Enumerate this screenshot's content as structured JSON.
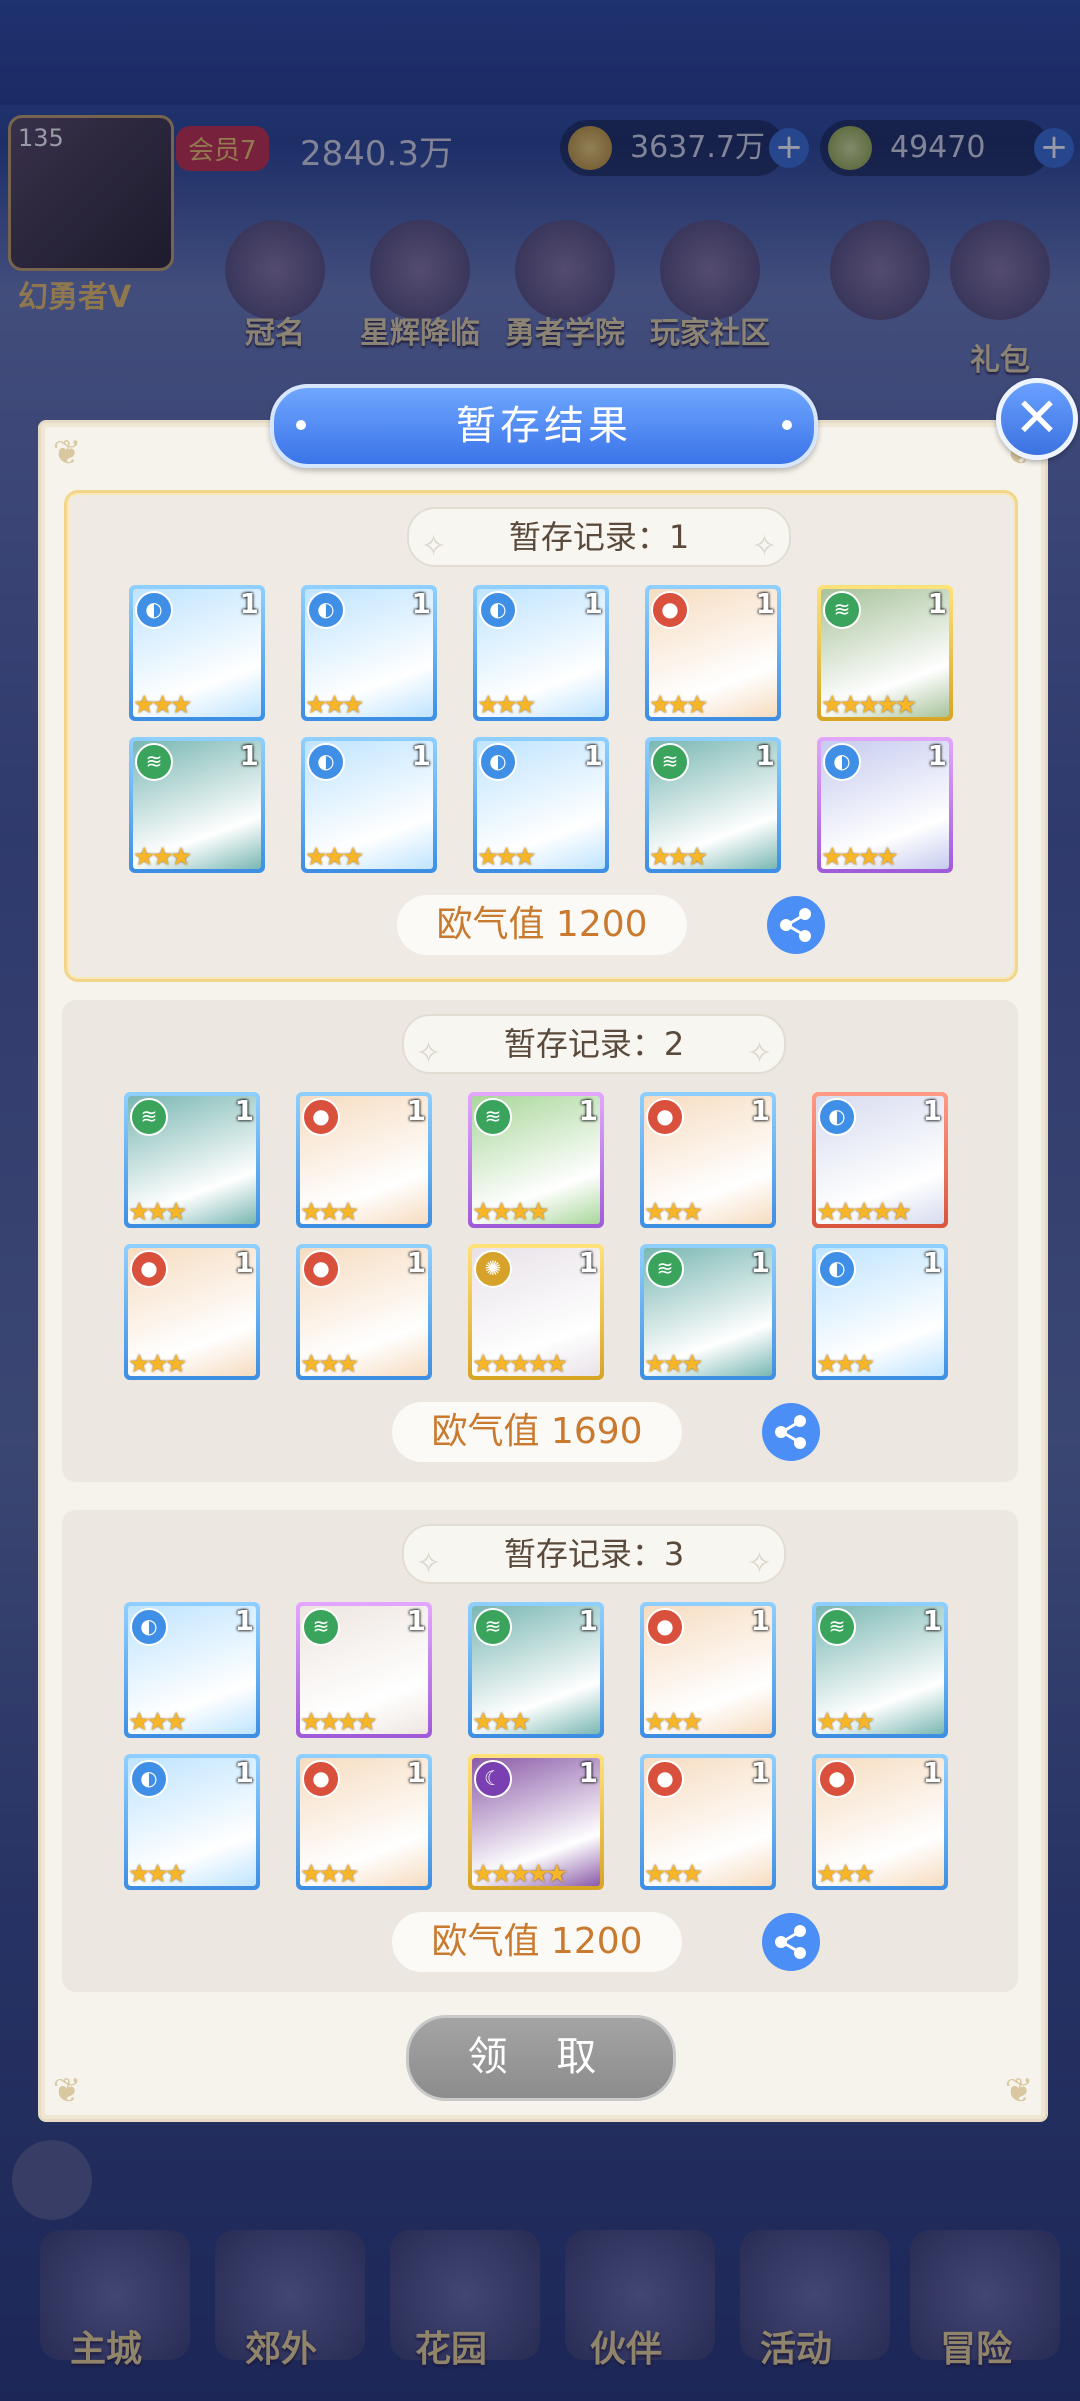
{
  "hud": {
    "level": "135",
    "username": "幻勇者V",
    "vip": "会员7",
    "power": "2840.3万",
    "gold": "3637.7万",
    "gems": "49470"
  },
  "menu": [
    "冠名",
    "星辉降临",
    "勇者学院",
    "玩家社区",
    "礼包"
  ],
  "nav": [
    "主城",
    "郊外",
    "花园",
    "伙伴",
    "活动",
    "冒险"
  ],
  "modal": {
    "title": "暂存结果",
    "claim_label": "领 取",
    "records": [
      {
        "label": "暂存记录：1",
        "score": "欧气值 1200",
        "cards": [
          {
            "rarity": "blue",
            "element": "water",
            "stars": "★★★",
            "count": "1",
            "art": "#bfe4ff"
          },
          {
            "rarity": "blue",
            "element": "water",
            "stars": "★★★",
            "count": "1",
            "art": "#bfe4ff"
          },
          {
            "rarity": "blue",
            "element": "water",
            "stars": "★★★",
            "count": "1",
            "art": "#bfe4ff"
          },
          {
            "rarity": "blue",
            "element": "fire",
            "stars": "★★★",
            "count": "1",
            "art": "#f6dcc0"
          },
          {
            "rarity": "gold",
            "element": "wind",
            "stars": "★★★★★",
            "count": "1",
            "art": "#a7c29a"
          },
          {
            "rarity": "blue",
            "element": "wind",
            "stars": "★★★",
            "count": "1",
            "art": "#79b7b2"
          },
          {
            "rarity": "blue",
            "element": "water",
            "stars": "★★★",
            "count": "1",
            "art": "#bfe4ff"
          },
          {
            "rarity": "blue",
            "element": "water",
            "stars": "★★★",
            "count": "1",
            "art": "#bfe4ff"
          },
          {
            "rarity": "blue",
            "element": "wind",
            "stars": "★★★",
            "count": "1",
            "art": "#79b7b2"
          },
          {
            "rarity": "purple",
            "element": "water",
            "stars": "★★★★",
            "count": "1",
            "art": "#c5cbef"
          }
        ]
      },
      {
        "label": "暂存记录：2",
        "score": "欧气值 1690",
        "cards": [
          {
            "rarity": "blue",
            "element": "wind",
            "stars": "★★★",
            "count": "1",
            "art": "#79b7b2"
          },
          {
            "rarity": "blue",
            "element": "fire",
            "stars": "★★★",
            "count": "1",
            "art": "#f6dcc0"
          },
          {
            "rarity": "purple",
            "element": "wind",
            "stars": "★★★★",
            "count": "1",
            "art": "#a9d79a"
          },
          {
            "rarity": "blue",
            "element": "fire",
            "stars": "★★★",
            "count": "1",
            "art": "#f6dcc0"
          },
          {
            "rarity": "red",
            "element": "water",
            "stars": "★★★★★",
            "count": "1",
            "art": "#d7dcef"
          },
          {
            "rarity": "blue",
            "element": "fire",
            "stars": "★★★",
            "count": "1",
            "art": "#f6dcc0"
          },
          {
            "rarity": "blue",
            "element": "fire",
            "stars": "★★★",
            "count": "1",
            "art": "#f6dcc0"
          },
          {
            "rarity": "gold",
            "element": "light",
            "stars": "★★★★★",
            "count": "1",
            "art": "#e8e2e8"
          },
          {
            "rarity": "blue",
            "element": "wind",
            "stars": "★★★",
            "count": "1",
            "art": "#79b7b2"
          },
          {
            "rarity": "blue",
            "element": "water",
            "stars": "★★★",
            "count": "1",
            "art": "#bfe4ff"
          }
        ]
      },
      {
        "label": "暂存记录：3",
        "score": "欧气值 1200",
        "cards": [
          {
            "rarity": "blue",
            "element": "water",
            "stars": "★★★",
            "count": "1",
            "art": "#bfe4ff"
          },
          {
            "rarity": "purple",
            "element": "wind",
            "stars": "★★★★",
            "count": "1",
            "art": "#eee6e0"
          },
          {
            "rarity": "blue",
            "element": "wind",
            "stars": "★★★",
            "count": "1",
            "art": "#79b7b2"
          },
          {
            "rarity": "blue",
            "element": "fire",
            "stars": "★★★",
            "count": "1",
            "art": "#f6dcc0"
          },
          {
            "rarity": "blue",
            "element": "wind",
            "stars": "★★★",
            "count": "1",
            "art": "#79b7b2"
          },
          {
            "rarity": "blue",
            "element": "water",
            "stars": "★★★",
            "count": "1",
            "art": "#bfe4ff"
          },
          {
            "rarity": "blue",
            "element": "fire",
            "stars": "★★★",
            "count": "1",
            "art": "#f6dcc0"
          },
          {
            "rarity": "gold",
            "element": "dark",
            "stars": "★★★★★",
            "count": "1",
            "art": "#8a5aa8"
          },
          {
            "rarity": "blue",
            "element": "fire",
            "stars": "★★★",
            "count": "1",
            "art": "#f6dcc0"
          },
          {
            "rarity": "blue",
            "element": "fire",
            "stars": "★★★",
            "count": "1",
            "art": "#f6dcc0"
          }
        ]
      }
    ]
  },
  "colors": {
    "water": "#3f8fe6",
    "fire": "#d9503c",
    "wind": "#3aa35c",
    "light": "#d6a22a",
    "dark": "#7a3fb0"
  }
}
